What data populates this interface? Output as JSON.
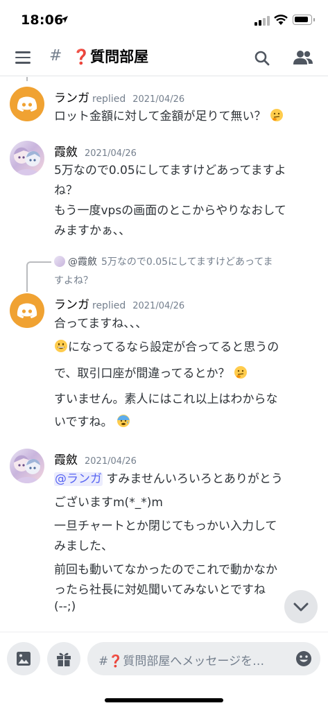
{
  "status_bar": {
    "time": "18:06",
    "battery_level": 0.85
  },
  "header": {
    "hash": "#",
    "channel_name": "❓質問部屋"
  },
  "messages": [
    {
      "author": "ランガ",
      "replied": "replied",
      "timestamp": "2021/04/26",
      "lines": [
        "ロット金額に対して金額が足りて無い？"
      ]
    },
    {
      "author": "霞斂",
      "timestamp": "2021/04/26",
      "lines": [
        "5万なので0.05にしてますけどあってますよ",
        "ね？",
        "もう一度vpsの画面のとこからやりなおして",
        "みますかぁ、、"
      ]
    },
    {
      "reply_to_author": "@霞斂",
      "reply_preview_1": "5万なので0.05にしてますけどあってま",
      "reply_preview_2": "すよね？",
      "author": "ランガ",
      "replied": "replied",
      "timestamp": "2021/04/26",
      "lines": [
        "合ってますね、、、",
        "になってるなら設定が合ってると思うの",
        "で、取引口座が間違ってるとか？",
        "すいません。素人にはこれ以上はわからな",
        "いですね。"
      ]
    },
    {
      "author": "霞斂",
      "timestamp": "2021/04/26",
      "mention": "@ランガ",
      "lines": [
        " すみませんいろいろとありがとう",
        "ございますm(*_*)m",
        "一旦チャートとか閉じてもっかい入力して",
        "みました、",
        "前回も動いてなかったのでこれで動かなか",
        "ったら社長に対処聞いてみないとですね",
        "(--;)"
      ]
    }
  ],
  "input": {
    "placeholder": "#❓質問部屋へメッセージを…"
  },
  "icons": {
    "menu": "hamburger-icon",
    "search": "search-icon",
    "members": "members-icon",
    "image": "image-icon",
    "gift": "gift-icon",
    "emoji": "emoji-icon",
    "scroll": "chevron-down-icon"
  },
  "colors": {
    "accent": "#5865f2",
    "discord_avatar": "#f0a232"
  }
}
